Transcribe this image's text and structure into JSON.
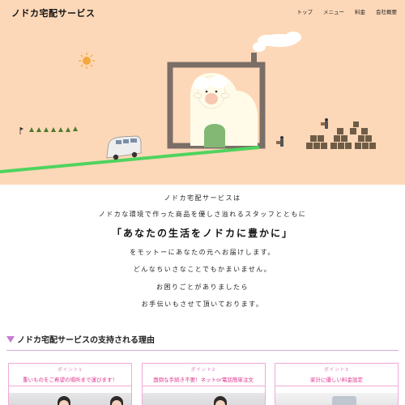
{
  "header": {
    "logo": "ノドカ宅配サービス",
    "nav": [
      "トップ",
      "メニュー",
      "料金",
      "会社概要"
    ]
  },
  "intro": {
    "lines": [
      "ノドカ宅配サービスは",
      "ノドカな環境で作った商品を優しさ溢れるスタッフとともに",
      "「あなたの生活をノドカに豊かに」",
      "をモットーにあなたの元へお届けします。",
      "どんなちいさなことでもかまいません。",
      "お困りごとがありましたら",
      "お手伝いもさせて頂いております。"
    ]
  },
  "reasons": {
    "title": "ノドカ宅配サービスの支持される理由",
    "cards": [
      {
        "point": "ポイント1",
        "desc": "重いものをご希望の場所まで運びます！"
      },
      {
        "point": "ポイント2",
        "desc": "面倒な手続き不要！ネットor電話簡単注文"
      },
      {
        "point": "ポイント3",
        "desc": "家計に優しい料金設定"
      }
    ]
  },
  "colors": {
    "hero_bg": "#fdd8b8",
    "accent_pink": "#e0338c",
    "accent_purple": "#c77bd0",
    "road_green": "#4fd35f"
  }
}
